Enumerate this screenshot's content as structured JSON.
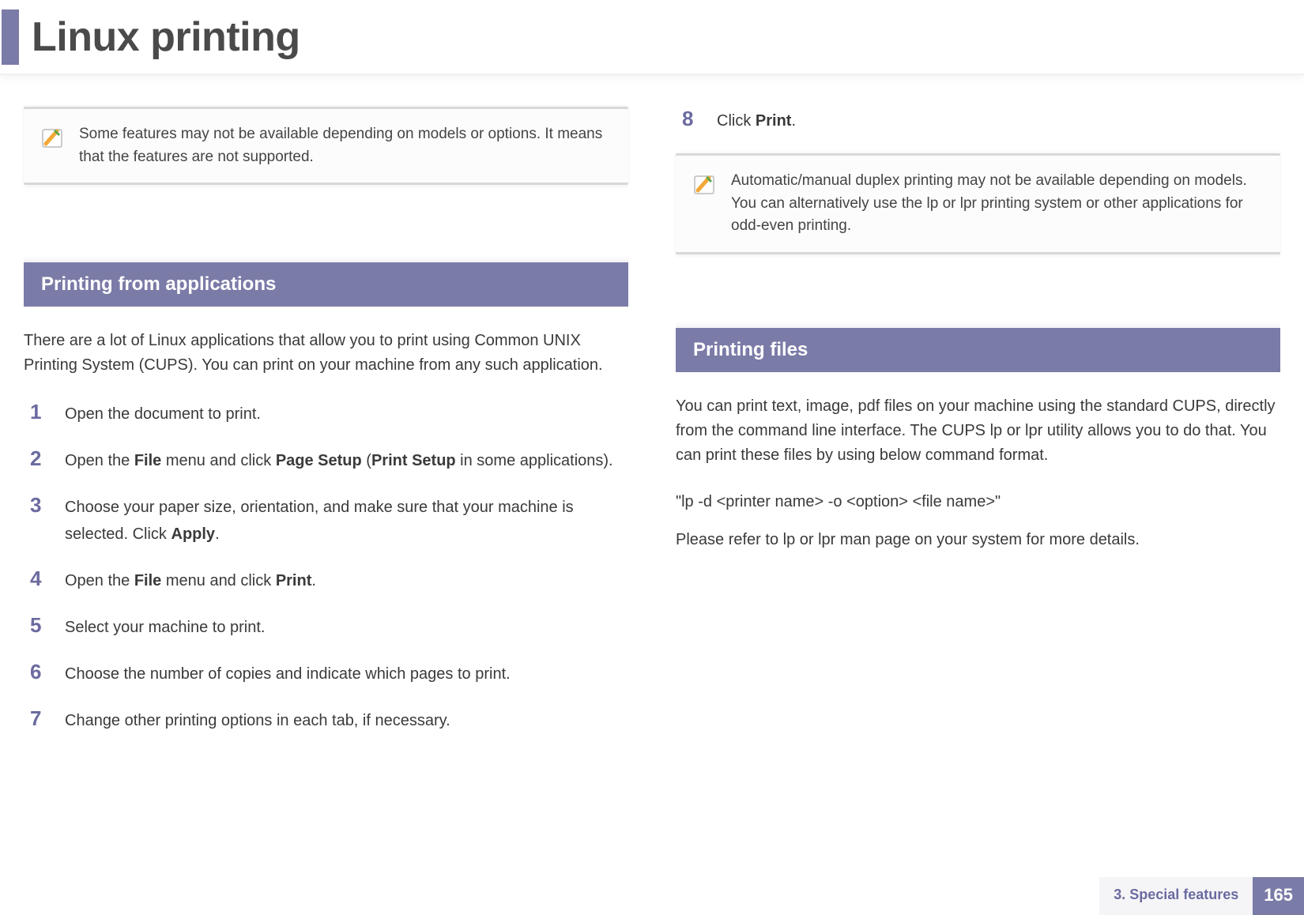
{
  "header": {
    "title": "Linux printing"
  },
  "col1": {
    "note1": "Some features may not be available depending on models or options. It means that the features are not supported.",
    "section1": {
      "title": "Printing from applications",
      "intro": "There are a lot of Linux applications that allow you to print using Common UNIX Printing System (CUPS). You can print on your machine from any such application.",
      "steps": {
        "s1": {
          "num": "1",
          "text": "Open the document to print."
        },
        "s2": {
          "num": "2",
          "pre": "Open the ",
          "b1": "File",
          "mid1": " menu and click ",
          "b2": "Page Setup",
          "mid2": " (",
          "b3": "Print Setup",
          "post": " in some applications)."
        },
        "s3": {
          "num": "3",
          "pre": "Choose your paper size, orientation, and make sure that your machine is selected. Click ",
          "b1": "Apply",
          "post": "."
        },
        "s4": {
          "num": "4",
          "pre": "Open the ",
          "b1": "File",
          "mid1": " menu and click ",
          "b2": "Print",
          "post": "."
        },
        "s5": {
          "num": "5",
          "text": "Select your machine to print."
        },
        "s6": {
          "num": "6",
          "text": "Choose the number of copies and indicate which pages to print."
        },
        "s7": {
          "num": "7",
          "text": "Change other printing options in each tab, if necessary."
        }
      }
    }
  },
  "col2": {
    "step8": {
      "num": "8",
      "pre": "Click ",
      "b1": "Print",
      "post": "."
    },
    "note2": "Automatic/manual duplex printing may not be available depending on models. You can alternatively use the lp or lpr printing system or other applications for odd-even printing.",
    "section2": {
      "title": "Printing files",
      "p1": "You can print text, image, pdf files on your machine using the standard CUPS, directly from the command line interface. The CUPS lp or lpr utility allows you to do that. You can print these files by using below command format.",
      "cmd": "\"lp -d <printer name> -o <option> <file name>\"",
      "p2": "Please refer to lp or lpr man page on your system for more details."
    }
  },
  "footer": {
    "chapter": "3.  Special features",
    "page": "165"
  }
}
